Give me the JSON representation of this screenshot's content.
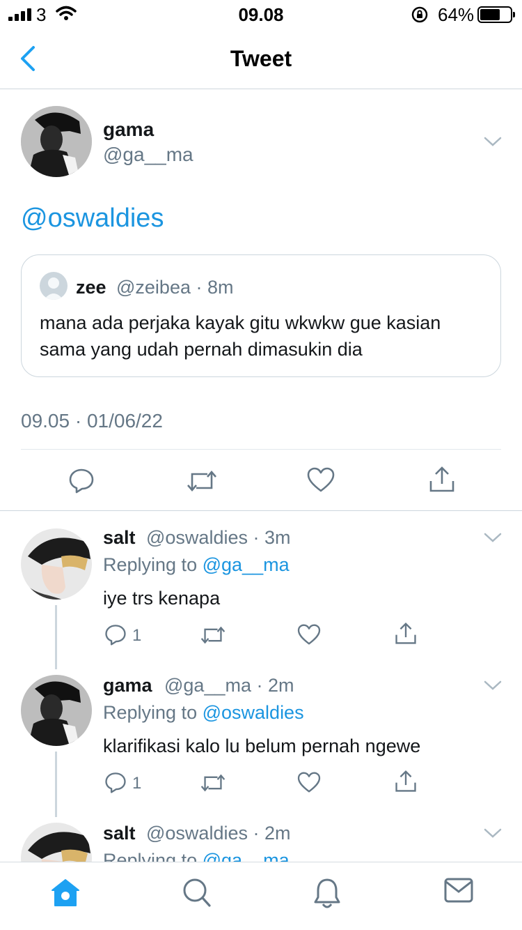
{
  "status_bar": {
    "carrier": "3",
    "time": "09.08",
    "battery": "64%"
  },
  "nav": {
    "title": "Tweet"
  },
  "main_tweet": {
    "name": "gama",
    "handle": "@ga__ma",
    "text": "@oswaldies",
    "quote": {
      "name": "zee",
      "meta": "@zeibea · 8m",
      "text": "mana ada perjaka kayak gitu wkwkw gue kasian sama yang udah pernah dimasukin dia"
    },
    "timestamp": "09.05 · 01/06/22"
  },
  "replies": [
    {
      "name": "salt",
      "meta": "@oswaldies · 3m",
      "replying_prefix": "Replying to",
      "replying_to": "@ga__ma",
      "text": "iye trs kenapa",
      "reply_count": "1"
    },
    {
      "name": "gama",
      "meta": "@ga__ma · 2m",
      "replying_prefix": "Replying to",
      "replying_to": "@oswaldies",
      "text": "klarifikasi kalo lu belum pernah ngewe",
      "reply_count": "1"
    },
    {
      "name": "salt",
      "meta": "@oswaldies · 2m",
      "replying_prefix": "Replying to",
      "replying_to": "@ga__ma"
    }
  ],
  "tabs": [
    {
      "icon": "home-icon"
    },
    {
      "icon": "search-icon"
    },
    {
      "icon": "notifications-icon"
    },
    {
      "icon": "messages-icon"
    }
  ],
  "colors": {
    "accent": "#1da1f2",
    "link": "#1b95e0",
    "secondary_text": "#657786",
    "border": "#ccd6dd"
  }
}
